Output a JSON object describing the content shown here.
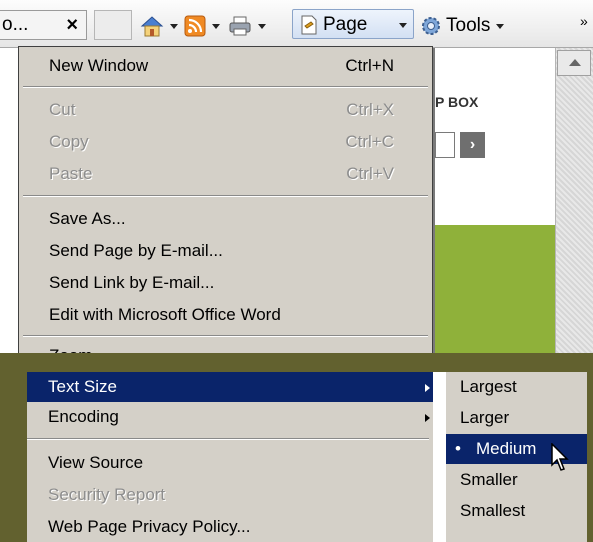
{
  "toolbar": {
    "tab_title": "o...",
    "tab_close": "×",
    "home_icon": "home-icon",
    "feeds_icon": "feeds-icon",
    "print_icon": "print-icon",
    "page_icon": "page-icon",
    "tools_icon": "gear-icon",
    "page_label": "Page",
    "tools_label": "Tools",
    "overflow": "»"
  },
  "webpage": {
    "box_label": "P BOX",
    "go_label": "›"
  },
  "page_menu": {
    "new_window": {
      "label": "New Window",
      "shortcut": "Ctrl+N"
    },
    "cut": {
      "label": "Cut",
      "shortcut": "Ctrl+X"
    },
    "copy": {
      "label": "Copy",
      "shortcut": "Ctrl+C"
    },
    "paste": {
      "label": "Paste",
      "shortcut": "Ctrl+V"
    },
    "save_as": "Save As...",
    "send_page": "Send Page by E-mail...",
    "send_link": "Send Link by E-mail...",
    "edit_word": "Edit with Microsoft Office Word",
    "zoom": "Zoom",
    "text_size": "Text Size",
    "encoding": "Encoding",
    "view_source": "View Source",
    "security_report": "Security Report",
    "privacy_policy": "Web Page Privacy Policy..."
  },
  "text_size_menu": {
    "largest": "Largest",
    "larger": "Larger",
    "medium": "Medium",
    "smaller": "Smaller",
    "smallest": "Smallest",
    "bullet": "•"
  },
  "colors": {
    "highlight": "#0a246a",
    "frame": "#62612f",
    "menu_bg": "#d4d0c8"
  }
}
